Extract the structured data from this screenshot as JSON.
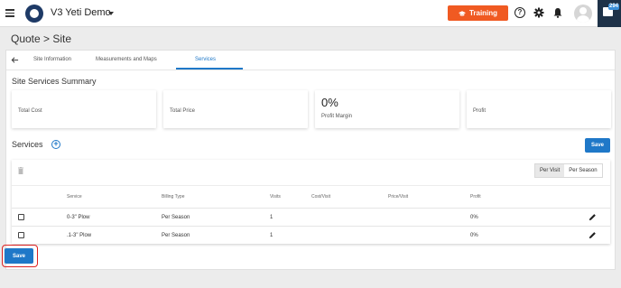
{
  "header": {
    "app_title": "V3 Yeti Demo",
    "training_label": "Training",
    "help_symbol": "?",
    "chat_badge": "294"
  },
  "page": {
    "title": "Quote > Site"
  },
  "tabs": [
    {
      "label": "Site Information",
      "active": false
    },
    {
      "label": "Measurements and Maps",
      "active": false
    },
    {
      "label": "Services",
      "active": true
    }
  ],
  "summary": {
    "title": "Site Services Summary",
    "cards": [
      {
        "label": "Total Cost",
        "value": ""
      },
      {
        "label": "Total Price",
        "value": ""
      },
      {
        "label": "Profit Margin",
        "value": "0%"
      },
      {
        "label": "Profit",
        "value": ""
      }
    ]
  },
  "services": {
    "title": "Services",
    "save_label": "Save",
    "toggle": {
      "options": [
        "Per Visit",
        "Per Season"
      ],
      "selected": "Per Visit"
    },
    "columns": [
      "Service",
      "Billing Type",
      "Visits",
      "Cost/Visit",
      "Price/Visit",
      "Profit"
    ],
    "rows": [
      {
        "service": "0-3\" Plow",
        "billing_type": "Per Season",
        "visits": "1",
        "cost_visit": "",
        "price_visit": "",
        "profit": "0%"
      },
      {
        "service": ".1-3\" Plow",
        "billing_type": "Per Season",
        "visits": "1",
        "cost_visit": "",
        "price_visit": "",
        "profit": "0%"
      }
    ]
  },
  "footer": {
    "save_label": "Save"
  },
  "colors": {
    "accent": "#1f78c8",
    "training": "#f05a22",
    "highlight": "#dd2222"
  }
}
